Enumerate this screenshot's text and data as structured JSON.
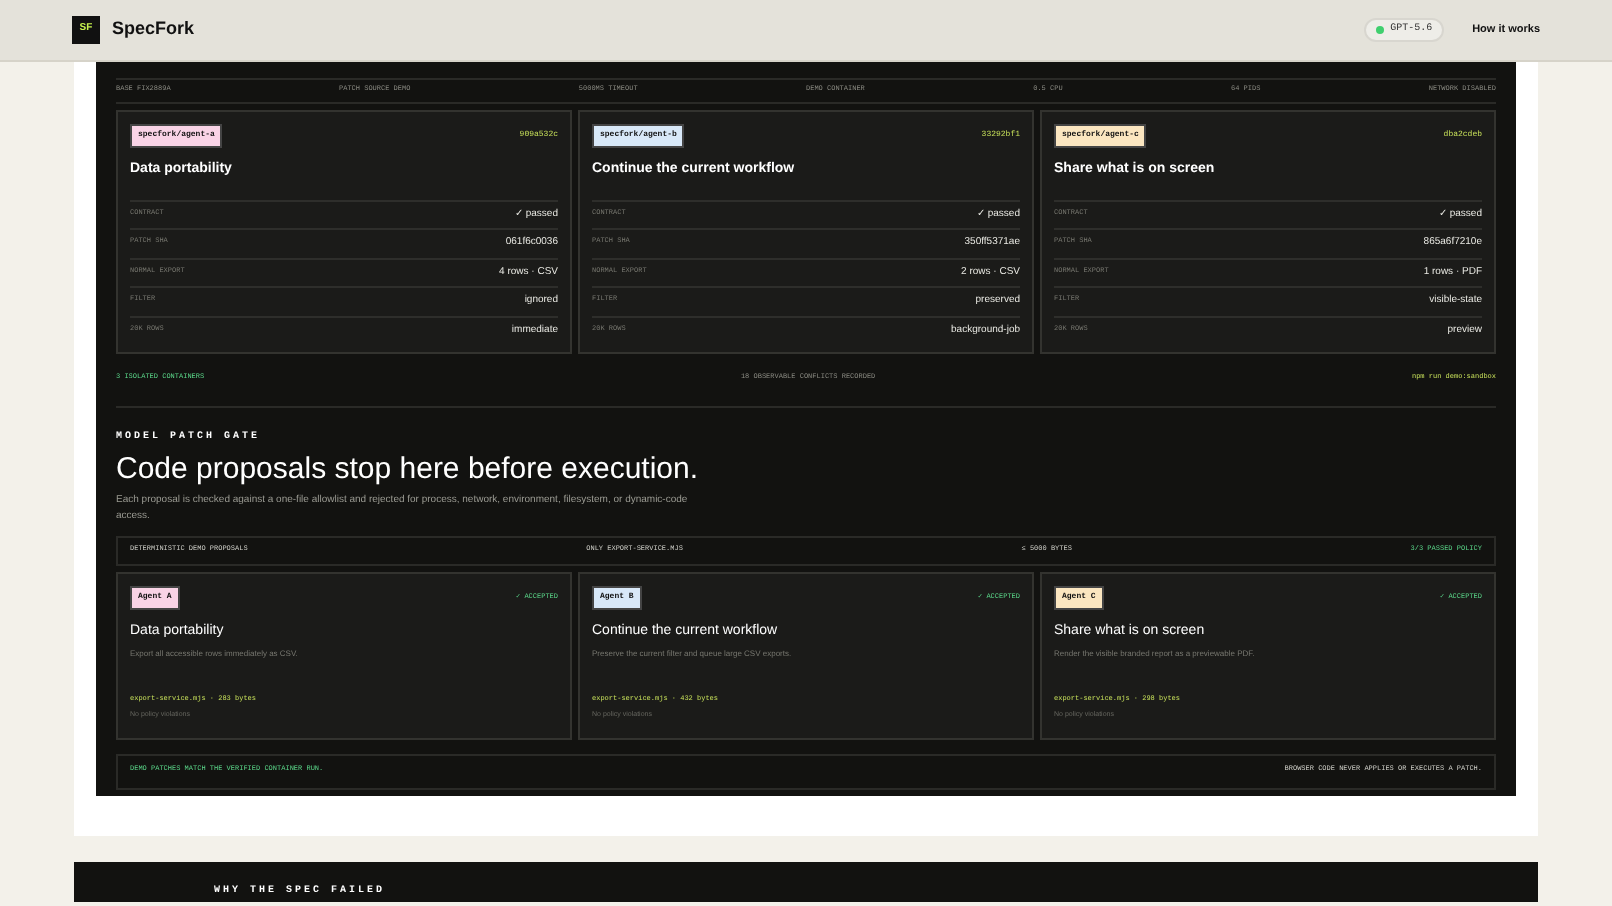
{
  "header": {
    "logo": "SF",
    "brand": "SpecFork",
    "model_badge": {
      "label": "GPT-5.6",
      "online": true
    },
    "nav_link": "How it works"
  },
  "spec_strip": [
    "BASE FIX2889A",
    "PATCH SOURCE DEMO",
    "5000MS TIMEOUT",
    "DEMO CONTAINER",
    "0.5 CPU",
    "64 PIDS",
    "NETWORK DISABLED"
  ],
  "containers": [
    {
      "tag": "specfork/agent-a",
      "color": "#f9d3e6",
      "hash": "909a532c",
      "title": "Data portability",
      "rows": [
        {
          "label": "CONTRACT",
          "value": "✓ passed"
        },
        {
          "label": "PATCH SHA",
          "value": "061f6c0036"
        },
        {
          "label": "NORMAL EXPORT",
          "value": "4 rows · CSV"
        },
        {
          "label": "FILTER",
          "value": "ignored"
        },
        {
          "label": "20K ROWS",
          "value": "immediate"
        }
      ]
    },
    {
      "tag": "specfork/agent-b",
      "color": "#d8e8f8",
      "hash": "33292bf1",
      "title": "Continue the current workflow",
      "rows": [
        {
          "label": "CONTRACT",
          "value": "✓ passed"
        },
        {
          "label": "PATCH SHA",
          "value": "350ff5371ae"
        },
        {
          "label": "NORMAL EXPORT",
          "value": "2 rows · CSV"
        },
        {
          "label": "FILTER",
          "value": "preserved"
        },
        {
          "label": "20K ROWS",
          "value": "background-job"
        }
      ]
    },
    {
      "tag": "specfork/agent-c",
      "color": "#fbe6c0",
      "hash": "dba2cdeb",
      "title": "Share what is on screen",
      "rows": [
        {
          "label": "CONTRACT",
          "value": "✓ passed"
        },
        {
          "label": "PATCH SHA",
          "value": "865a6f7210e"
        },
        {
          "label": "NORMAL EXPORT",
          "value": "1 rows · PDF"
        },
        {
          "label": "FILTER",
          "value": "visible-state"
        },
        {
          "label": "20K ROWS",
          "value": "preview"
        }
      ]
    }
  ],
  "container_footer": {
    "left": "3 ISOLATED CONTAINERS",
    "middle": "18 OBSERVABLE CONFLICTS RECORDED",
    "command": "npm run demo:sandbox"
  },
  "gate": {
    "eyebrow": "MODEL PATCH GATE",
    "heading": "Code proposals stop here before execution.",
    "description": "Each proposal is checked against a one-file allowlist and rejected for process, network, environment, filesystem, or dynamic-code access.",
    "policy_bar": [
      "DETERMINISTIC DEMO PROPOSALS",
      "ONLY EXPORT-SERVICE.MJS",
      "≤ 5000 BYTES",
      "3/3 PASSED POLICY"
    ],
    "proposals": [
      {
        "agent": "Agent A",
        "color": "#f9d3e6",
        "status": "✓ ACCEPTED",
        "title": "Data portability",
        "description": "Export all accessible rows immediately as CSV.",
        "file": "export-service.mjs · 283 bytes",
        "policy": "No policy violations"
      },
      {
        "agent": "Agent B",
        "color": "#d8e8f8",
        "status": "✓ ACCEPTED",
        "title": "Continue the current workflow",
        "description": "Preserve the current filter and queue large CSV exports.",
        "file": "export-service.mjs · 432 bytes",
        "policy": "No policy violations"
      },
      {
        "agent": "Agent C",
        "color": "#fbe6c0",
        "status": "✓ ACCEPTED",
        "title": "Share what is on screen",
        "description": "Render the visible branded report as a previewable PDF.",
        "file": "export-service.mjs · 298 bytes",
        "policy": "No policy violations"
      }
    ],
    "footer": {
      "left": "DEMO PATCHES MATCH THE VERIFIED CONTAINER RUN.",
      "right": "BROWSER CODE NEVER APPLIES OR EXECUTES A PATCH."
    }
  },
  "next_section": {
    "eyebrow": "WHY THE SPEC FAILED"
  }
}
